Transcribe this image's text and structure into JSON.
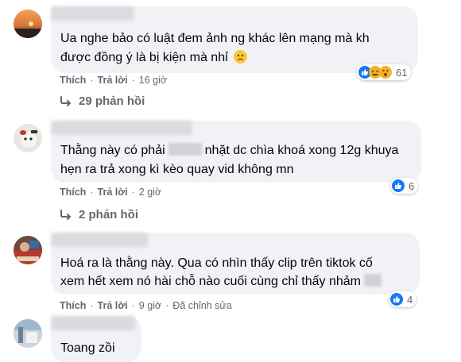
{
  "comments": [
    {
      "text_lines": [
        "Ua nghe bảo có luật đem ảnh ng khác lên mạng mà kh",
        "được đồng ý là bị kiện mà nhỉ"
      ],
      "like_label": "Thích",
      "reply_label": "Trả lời",
      "time": "16 giờ",
      "reaction_count": "61",
      "replies_label": "29 phản hồi"
    },
    {
      "text_line1_a": "Thằng này có phải",
      "text_line1_b": "nhặt dc chìa khoá xong 12g khuya",
      "text_line2": "hẹn ra trả xong kì kèo quay vid không mn",
      "like_label": "Thích",
      "reply_label": "Trả lời",
      "time": "2 giờ",
      "reaction_count": "6",
      "replies_label": "2 phản hồi"
    },
    {
      "text_line1": "Hoá ra là thằng này. Qua có nhìn thấy clip trên tiktok cố",
      "text_line2": "xem hết xem nó hài chỗ nào cuối cùng chỉ thấy nhảm",
      "like_label": "Thích",
      "reply_label": "Trả lời",
      "time": "9 giờ",
      "edited_label": "Đã chỉnh sửa",
      "reaction_count": "4"
    },
    {
      "text_line1": "Toang zồi"
    }
  ],
  "colors": {
    "bubble": "#f0f2f5",
    "meta": "#65676b",
    "like_blue": "#1877f2",
    "text": "#050505"
  }
}
